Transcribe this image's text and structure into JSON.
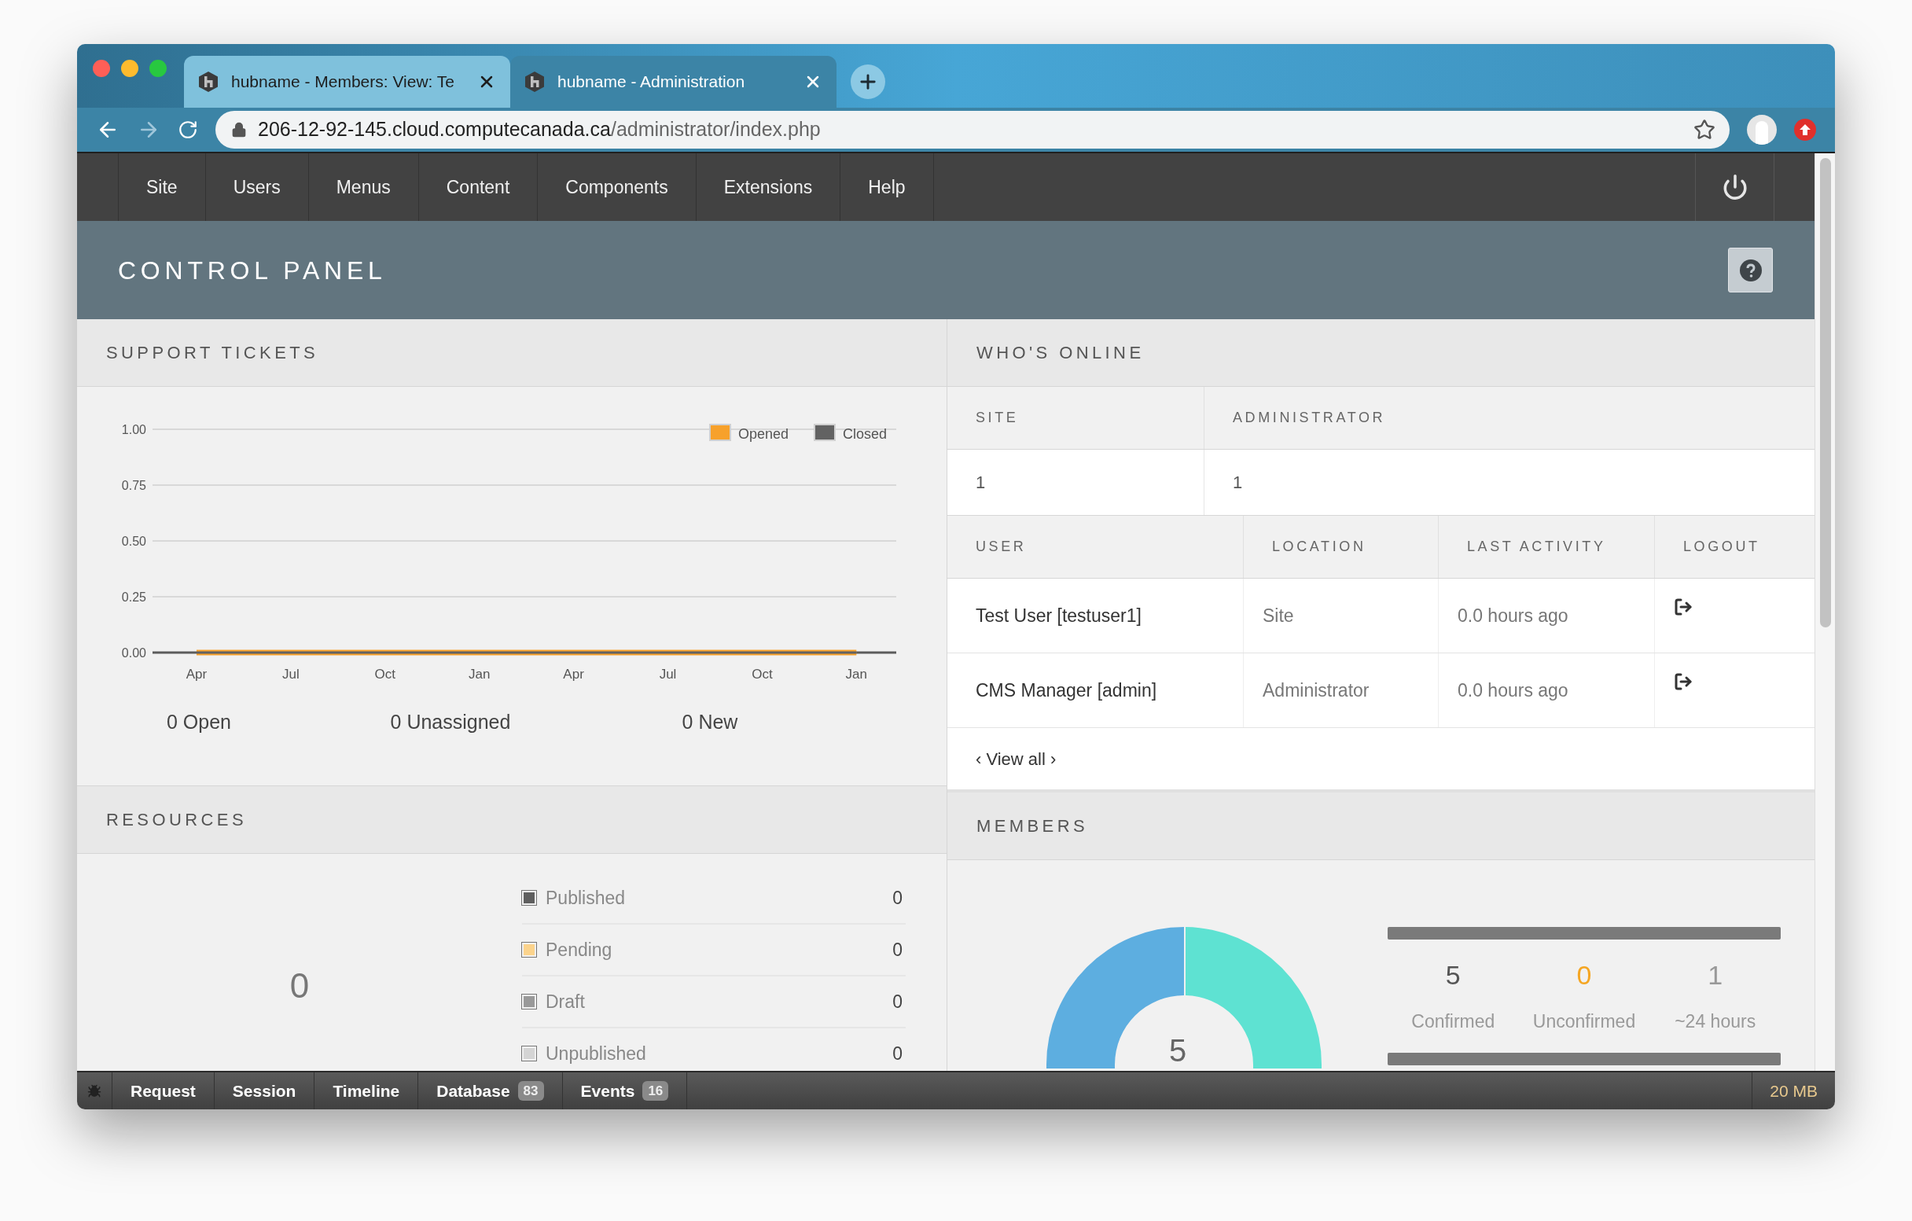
{
  "browser": {
    "tabs": [
      {
        "title": "hubname - Members: View: Te",
        "selected": false
      },
      {
        "title": "hubname - Administration",
        "selected": true
      }
    ],
    "url_host": "206-12-92-145.cloud.computecanada.ca",
    "url_path": "/administrator/index.php"
  },
  "nav": {
    "items": [
      "Site",
      "Users",
      "Menus",
      "Content",
      "Components",
      "Extensions",
      "Help"
    ]
  },
  "page_title": "CONTROL PANEL",
  "support_tickets": {
    "title": "SUPPORT TICKETS",
    "chart_data": {
      "type": "line",
      "categories": [
        "Apr",
        "Jul",
        "Oct",
        "Jan",
        "Apr",
        "Jul",
        "Oct",
        "Jan"
      ],
      "series": [
        {
          "name": "Opened",
          "color": "#f7a12b",
          "values": [
            0,
            0,
            0,
            0,
            0,
            0,
            0,
            0
          ]
        },
        {
          "name": "Closed",
          "color": "#626262",
          "values": [
            0,
            0,
            0,
            0,
            0,
            0,
            0,
            0
          ]
        }
      ],
      "grid": true,
      "legend": true,
      "ylim": [
        0,
        1
      ],
      "yticks": [
        {
          "value": 0,
          "label": "0.00"
        },
        {
          "value": 0.25,
          "label": "0.25"
        },
        {
          "value": 0.5,
          "label": "0.50"
        },
        {
          "value": 0.75,
          "label": "0.75"
        },
        {
          "value": 1,
          "label": "1.00"
        }
      ]
    },
    "stats": [
      "0 Open",
      "0 Unassigned",
      "0 New"
    ]
  },
  "resources": {
    "title": "RESOURCES",
    "total": "0",
    "items": [
      {
        "label": "Published",
        "count": "0",
        "color": "#5f5f5f"
      },
      {
        "label": "Pending",
        "count": "0",
        "color": "#fbd38c"
      },
      {
        "label": "Draft",
        "count": "0",
        "color": "#999999"
      },
      {
        "label": "Unpublished",
        "count": "0",
        "color": "#d4d4d4"
      }
    ]
  },
  "whos_online": {
    "title": "WHO'S ONLINE",
    "summary_columns": [
      "SITE",
      "ADMINISTRATOR"
    ],
    "summary_values": [
      "1",
      "1"
    ],
    "user_columns": [
      "USER",
      "LOCATION",
      "LAST ACTIVITY",
      "LOGOUT"
    ],
    "users": [
      {
        "user": "Test User [testuser1]",
        "location": "Site",
        "last_activity": "0.0 hours ago"
      },
      {
        "user": "CMS Manager [admin]",
        "location": "Administrator",
        "last_activity": "0.0 hours ago"
      }
    ],
    "view_all": "‹ View all ›"
  },
  "members": {
    "title": "MEMBERS",
    "donut_center": "5",
    "bars": [
      {
        "level": 1
      },
      {
        "level": 1
      }
    ],
    "stats": [
      {
        "value": "5",
        "label": "Confirmed",
        "color": "#555555"
      },
      {
        "value": "0",
        "label": "Unconfirmed",
        "color": "#f5a623"
      },
      {
        "value": "1",
        "label": "~24 hours",
        "color": "#999999"
      }
    ]
  },
  "debug_bar": {
    "items": [
      {
        "label": "Request"
      },
      {
        "label": "Session"
      },
      {
        "label": "Timeline"
      },
      {
        "label": "Database",
        "count": "83"
      },
      {
        "label": "Events",
        "count": "16"
      }
    ],
    "memory": "20 MB"
  }
}
